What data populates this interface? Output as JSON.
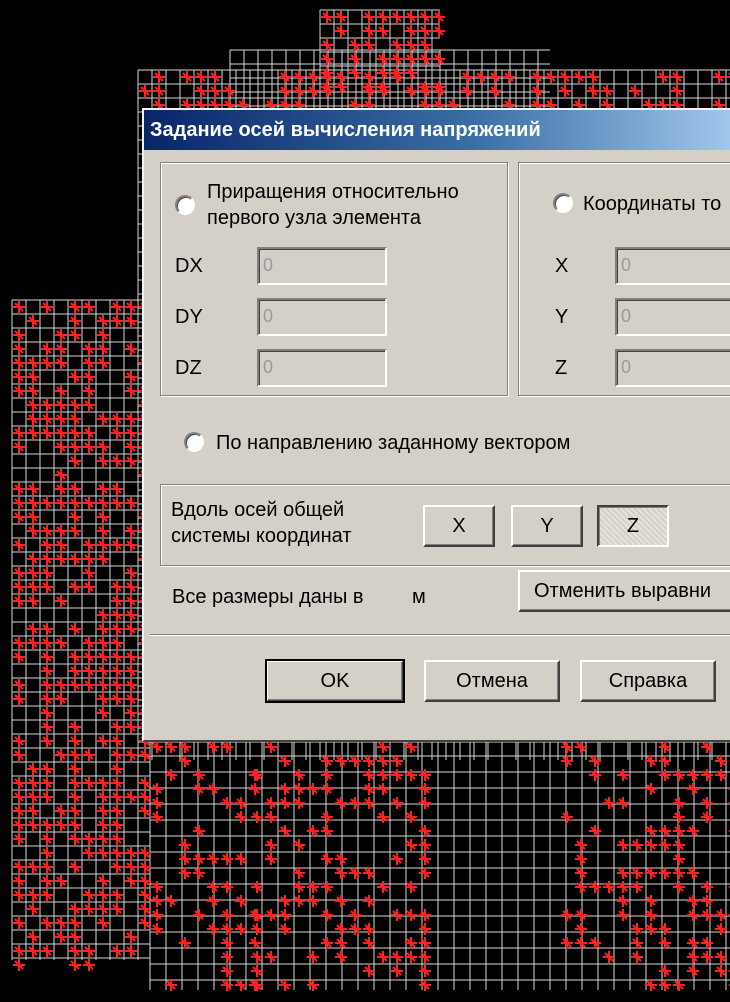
{
  "dialog": {
    "title": "Задание осей вычисления напряжений",
    "increments": {
      "label_line1": "Приращения относительно",
      "label_line2": "первого узла элемента",
      "fields": [
        {
          "label": "DX",
          "value": "0"
        },
        {
          "label": "DY",
          "value": "0"
        },
        {
          "label": "DZ",
          "value": "0"
        }
      ]
    },
    "coords": {
      "label": "Координаты то",
      "fields": [
        {
          "label": "X",
          "value": "0"
        },
        {
          "label": "Y",
          "value": "0"
        },
        {
          "label": "Z",
          "value": "0"
        }
      ]
    },
    "vector_option": "По направлению заданному вектором",
    "global_axes": {
      "label_line1": "Вдоль осей общей",
      "label_line2": "системы координат",
      "buttons": [
        "X",
        "Y",
        "Z"
      ],
      "pressed": "Z"
    },
    "units_label": "Все размеры даны в",
    "units_value": "м",
    "cancel_align_button": "Отменить выравни",
    "ok_button": "OK",
    "cancel_button": "Отмена",
    "help_button": "Справка"
  },
  "colors": {
    "background": "#000000",
    "mesh": "#ff2020",
    "grid": "#d8d8d8",
    "dialog": "#d4d0c8",
    "title_start": "#0a246a",
    "title_end": "#a6caf0"
  }
}
